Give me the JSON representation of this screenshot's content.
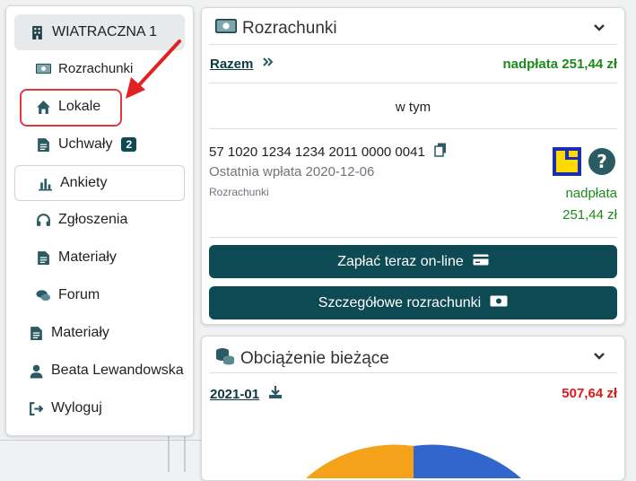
{
  "sidebar": {
    "building": "WIATRACZNA 1",
    "items": [
      {
        "label": "Rozrachunki"
      },
      {
        "label": "Lokale"
      },
      {
        "label": "Uchwały",
        "badge": "2"
      },
      {
        "label": "Ankiety"
      },
      {
        "label": "Zgłoszenia"
      },
      {
        "label": "Materiały"
      },
      {
        "label": "Forum"
      }
    ],
    "global_items": [
      {
        "label": "Materiały"
      },
      {
        "label": "Beata Lewandowska"
      },
      {
        "label": "Wyloguj"
      }
    ]
  },
  "rozrachunki": {
    "title": "Rozrachunki",
    "total_label": "Razem",
    "total_value": "nadpłata 251,44 zł",
    "section_label": "w tym",
    "account_number": "57 1020 1234 1234 2011 0000 0041",
    "last_payment": "Ostatnia wpłata 2020-12-06",
    "subtitle": "Rozrachunki",
    "status_label": "nadpłata",
    "status_amount": "251,44 zł",
    "pay_button": "Zapłać teraz on-line",
    "details_button": "Szczegółowe rozrachunki"
  },
  "obciazenie": {
    "title": "Obciążenie bieżące",
    "period": "2021-01",
    "amount": "507,64 zł"
  },
  "colors": {
    "primary": "#0e4a54",
    "positive": "#1e8a1e",
    "negative": "#e01818",
    "highlight": "#e03a3a",
    "pie_orange": "#f5a21b",
    "pie_blue": "#3366cc"
  }
}
